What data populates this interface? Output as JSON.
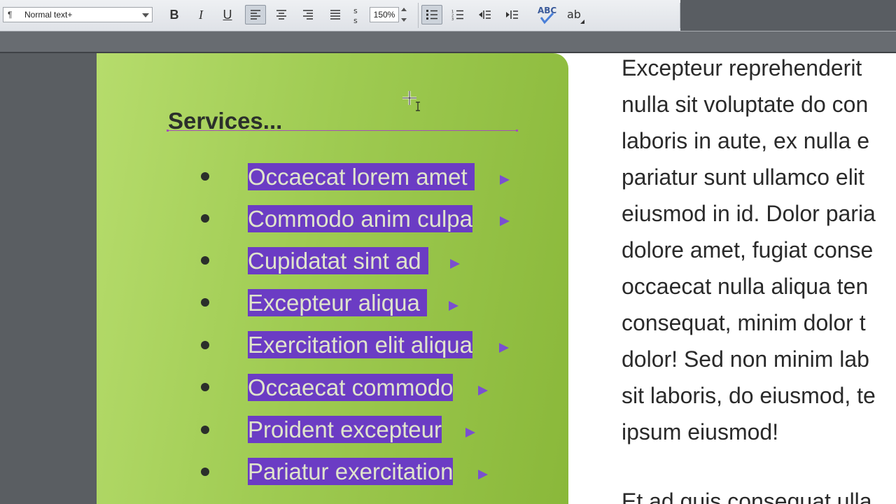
{
  "toolbar": {
    "style_dropdown_value": "Normal text+",
    "bold_label": "B",
    "italic_label": "I",
    "underline_label": "U",
    "zoom_value": "150%",
    "spellcheck_label": "ABC",
    "abbreviation_label": "ab"
  },
  "document": {
    "heading": "Services...",
    "services": [
      "Occaecat lorem amet ",
      "Commodo anim culpa",
      "Cupidatat sint ad ",
      "Excepteur aliqua ",
      "Exercitation elit aliqua",
      "Occaecat commodo",
      "Proident excepteur",
      "Pariatur exercitation",
      ""
    ],
    "body_lines": [
      "Excepteur reprehenderit",
      "nulla sit voluptate do con",
      "laboris in aute, ex nulla e",
      "pariatur sunt ullamco elit",
      "eiusmod in id. Dolor paria",
      "dolore amet, fugiat conse",
      "occaecat nulla aliqua ten",
      "consequat, minim dolor t",
      "dolor! Sed non minim lab",
      "sit laboris, do eiusmod, te",
      "ipsum eiusmod!"
    ],
    "next_paragraph_partial": "Et ad quis consequat ulla"
  },
  "colors": {
    "highlight": "#6b3cc4",
    "panel_green": "#9fcb52",
    "heading_underline": "#a44fb8"
  }
}
